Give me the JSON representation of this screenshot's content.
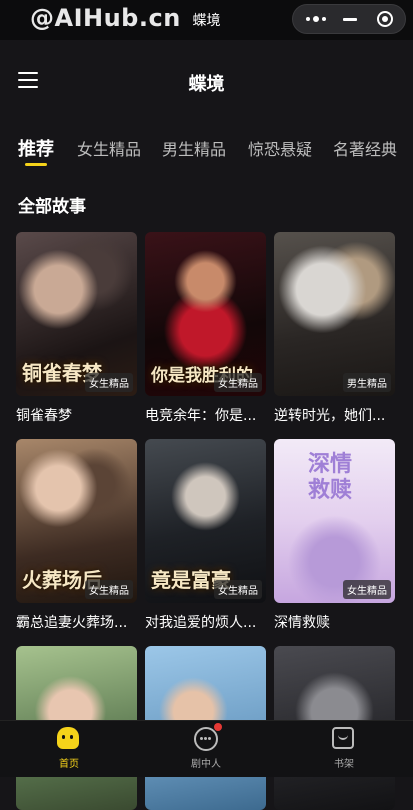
{
  "watermark": "@AIHub.cn",
  "window_title": "蝶境",
  "page_title": "蝶境",
  "tabs": [
    {
      "label": "推荐",
      "active": true
    },
    {
      "label": "女生精品",
      "active": false
    },
    {
      "label": "男生精品",
      "active": false
    },
    {
      "label": "惊恐悬疑",
      "active": false
    },
    {
      "label": "名著经典",
      "active": false
    }
  ],
  "section_title": "全部故事",
  "books": [
    {
      "title": "铜雀春梦",
      "badge": "女生精品",
      "cover_text": "铜雀春梦"
    },
    {
      "title": "电竞余年：你是...",
      "badge": "女生精品",
      "cover_text": "你是我胜利的"
    },
    {
      "title": "逆转时光，她们...",
      "badge": "男生精品",
      "cover_text": ""
    },
    {
      "title": "霸总追妻火葬场...",
      "badge": "女生精品",
      "cover_text": "火葬场后"
    },
    {
      "title": "对我追爱的烦人...",
      "badge": "女生精品",
      "cover_text": "竟是富豪"
    },
    {
      "title": "深情救赎",
      "badge": "女生精品",
      "cover_text": "深情救赎"
    },
    {
      "title": "",
      "badge": "",
      "cover_text": ""
    },
    {
      "title": "",
      "badge": "",
      "cover_text": ""
    },
    {
      "title": "",
      "badge": "",
      "cover_text": ""
    }
  ],
  "tabbar": [
    {
      "label": "首页",
      "icon": "home-icon",
      "active": true
    },
    {
      "label": "剧中人",
      "icon": "drama-icon",
      "active": false
    },
    {
      "label": "书架",
      "icon": "bookshelf-icon",
      "active": false
    }
  ],
  "colors": {
    "accent": "#f5d31a",
    "background": "#161518",
    "notification": "#e53935"
  }
}
